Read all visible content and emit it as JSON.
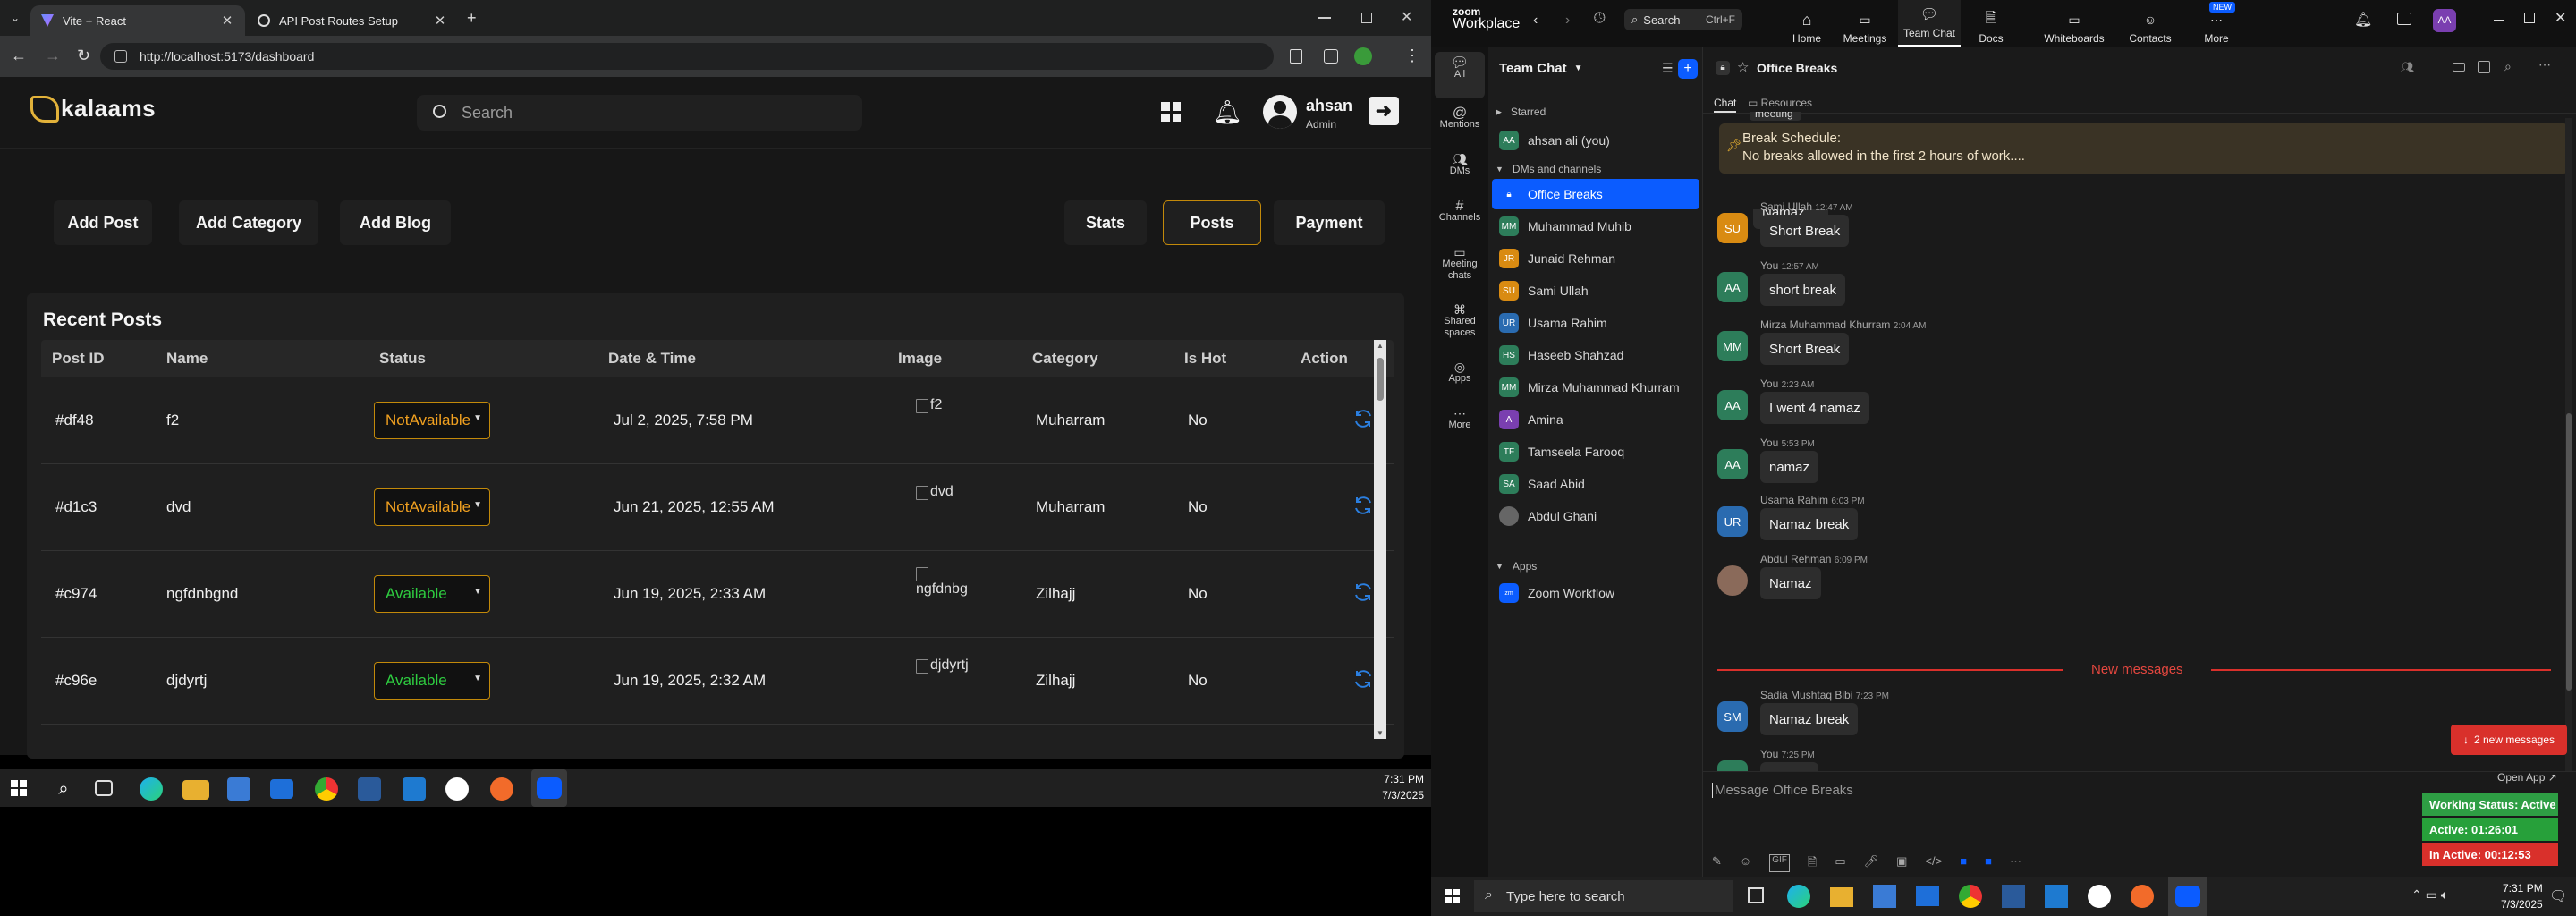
{
  "browser": {
    "tabs": [
      {
        "title": "Vite + React",
        "active": true
      },
      {
        "title": "API Post Routes Setup",
        "active": false
      }
    ],
    "url": "http://localhost:5173/dashboard"
  },
  "site": {
    "logo": "kalaams",
    "search_placeholder": "Search",
    "user_name": "ahsan",
    "user_role": "Admin",
    "left_nav": [
      "Add Post",
      "Add Category",
      "Add Blog"
    ],
    "right_nav": [
      "Stats",
      "Posts",
      "Payment"
    ],
    "active_nav": "Posts",
    "section_title": "Recent Posts",
    "table_headers": [
      "Post ID",
      "Name",
      "Status",
      "Date & Time",
      "Image",
      "Category",
      "Is Hot",
      "Action"
    ],
    "rows": [
      {
        "id": "#df48",
        "name": "f2",
        "status": "NotAvailable",
        "datetime": "Jul 2, 2025, 7:58 PM",
        "image_alt": "f2",
        "category": "Muharram",
        "is_hot": "No"
      },
      {
        "id": "#d1c3",
        "name": "dvd",
        "status": "NotAvailable",
        "datetime": "Jun 21, 2025, 12:55 AM",
        "image_alt": "dvd",
        "category": "Muharram",
        "is_hot": "No"
      },
      {
        "id": "#c974",
        "name": "ngfdnbgnd",
        "status": "Available",
        "datetime": "Jun 19, 2025, 2:33 AM",
        "image_alt": "ngfdnbg",
        "category": "Zilhajj",
        "is_hot": "No"
      },
      {
        "id": "#c96e",
        "name": "djdyrtj",
        "status": "Available",
        "datetime": "Jun 19, 2025, 2:32 AM",
        "image_alt": "djdyrtj",
        "category": "Zilhajj",
        "is_hot": "No"
      }
    ],
    "colors": {
      "not_available": "#f0a020",
      "available": "#2ecc40",
      "accent_border": "#c2890a",
      "refresh": "#2b7fe0"
    }
  },
  "taskbar_left": {
    "time": "7:31 PM",
    "date": "7/3/2025"
  },
  "zoom": {
    "brand_top": "zoom",
    "brand": "Workplace",
    "search_label": "Search",
    "search_shortcut": "Ctrl+F",
    "top_tabs": [
      "Home",
      "Meetings",
      "Team Chat",
      "Docs",
      "Whiteboards",
      "Contacts",
      "More"
    ],
    "active_tab": "Team Chat",
    "new_badge": "NEW",
    "user_initials": "AA",
    "rail": [
      "All",
      "Mentions",
      "DMs",
      "Channels",
      "Meeting chats",
      "Shared spaces",
      "Apps",
      "More"
    ],
    "list_title": "Team Chat",
    "sections": {
      "starred": "Starred",
      "dms": "DMs and channels",
      "apps": "Apps"
    },
    "starred": [
      {
        "initials": "AA",
        "name": "ahsan ali (you)",
        "color": "#2d7d5a"
      }
    ],
    "contacts": [
      {
        "initials": "",
        "name": "Office Breaks",
        "color": "#0b5cff",
        "active": true
      },
      {
        "initials": "MM",
        "name": "Muhammad Muhib",
        "color": "#2d7d5a"
      },
      {
        "initials": "JR",
        "name": "Junaid Rehman",
        "color": "#d98b12"
      },
      {
        "initials": "SU",
        "name": "Sami Ullah",
        "color": "#d98b12"
      },
      {
        "initials": "UR",
        "name": "Usama Rahim",
        "color": "#2a6bb0"
      },
      {
        "initials": "HS",
        "name": "Haseeb Shahzad",
        "color": "#2d7d5a"
      },
      {
        "initials": "MM",
        "name": "Mirza Muhammad Khurram",
        "color": "#2d7d5a"
      },
      {
        "initials": "A",
        "name": "Amina",
        "color": "#7a3fb0"
      },
      {
        "initials": "TF",
        "name": "Tamseela Farooq",
        "color": "#2d7d5a"
      },
      {
        "initials": "SA",
        "name": "Saad Abid",
        "color": "#2d7d5a"
      },
      {
        "initials": "",
        "name": "Abdul Ghani",
        "color": "#666"
      }
    ],
    "apps": [
      {
        "name": "Zoom Workflow",
        "color": "#0b5cff"
      }
    ],
    "channel_name": "Office Breaks",
    "chat_tabs": [
      "Chat",
      "Resources"
    ],
    "banner_title": "Break Schedule:",
    "banner_text": "No breaks allowed in the first 2 hours of work....",
    "partial_top": [
      "meeting",
      "Namaz Break"
    ],
    "messages": [
      {
        "initials": "SU",
        "author": "Sami Ullah",
        "time": "12:47 AM",
        "text": "Short Break",
        "color": "#d98b12"
      },
      {
        "initials": "AA",
        "author": "You",
        "time": "12:57 AM",
        "text": "short break",
        "color": "#2d7d5a"
      },
      {
        "initials": "MM",
        "author": "Mirza Muhammad Khurram",
        "time": "2:04 AM",
        "text": "Short Break",
        "color": "#2d7d5a"
      },
      {
        "initials": "AA",
        "author": "You",
        "time": "2:23 AM",
        "text": "I went 4 namaz",
        "color": "#2d7d5a"
      },
      {
        "initials": "AA",
        "author": "You",
        "time": "5:53 PM",
        "text": "namaz",
        "color": "#2d7d5a"
      },
      {
        "initials": "UR",
        "author": "Usama Rahim",
        "time": "6:03 PM",
        "text": "Namaz break",
        "color": "#2a6bb0"
      },
      {
        "initials": "",
        "author": "Abdul Rehman",
        "time": "6:09 PM",
        "text": "Namaz",
        "color": "#8a6a5a"
      }
    ],
    "new_messages_label": "New messages",
    "messages_after": [
      {
        "initials": "SM",
        "author": "Sadia Mushtaq Bibi",
        "time": "7:23 PM",
        "text": "Namaz break",
        "color": "#2a6bb0"
      },
      {
        "initials": "AA",
        "author": "You",
        "time": "7:25 PM",
        "text": "namaz",
        "color": "#2d7d5a"
      }
    ],
    "new_messages_button": "2 new messages",
    "composer_placeholder": "Message Office Breaks",
    "open_app": "Open App",
    "working_status": "Working Status: Active",
    "active_time": "Active: 01:26:01",
    "inactive_time": "In Active: 00:12:53",
    "status_colors": {
      "working": "#2e9e44",
      "active": "#27a03a",
      "inactive": "#d9302b"
    }
  },
  "taskbar_right": {
    "search_placeholder": "Type here to search",
    "time": "7:31 PM",
    "date": "7/3/2025"
  }
}
